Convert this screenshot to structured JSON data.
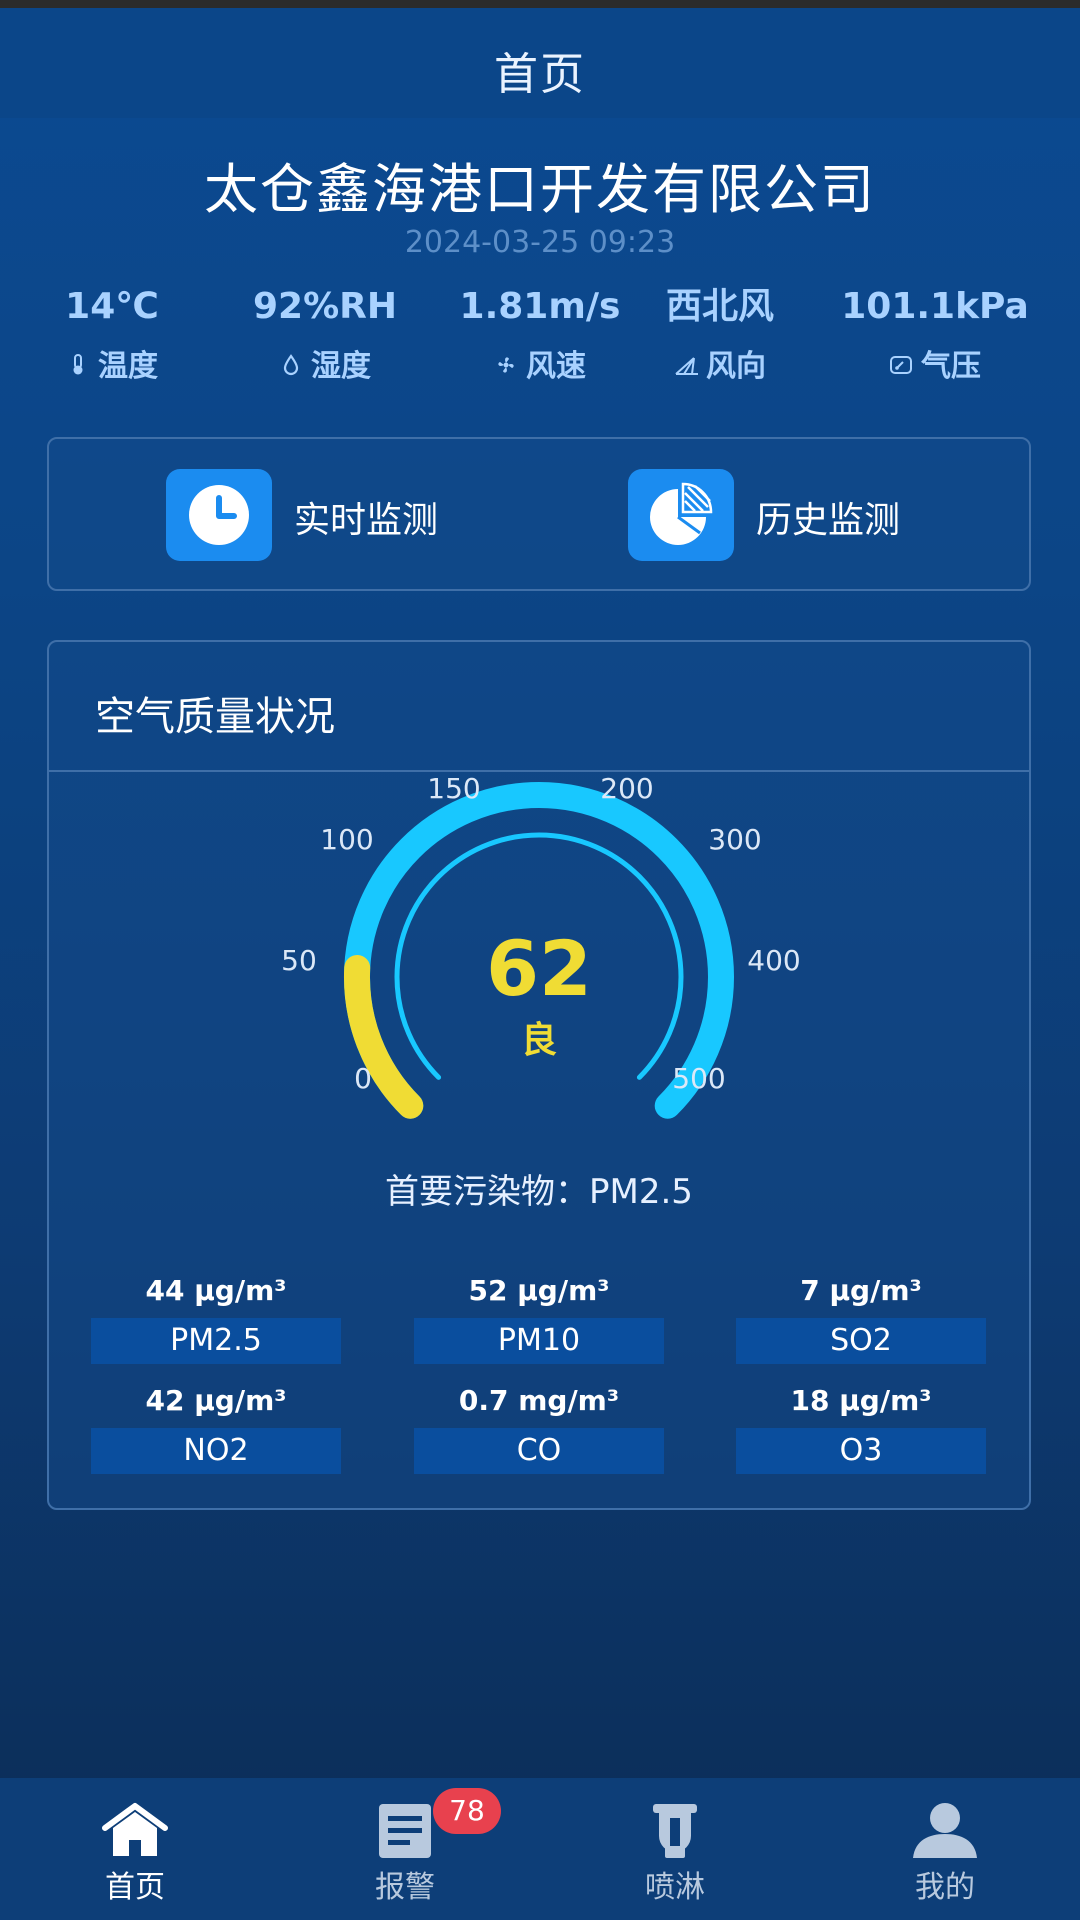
{
  "header": {
    "title": "首页"
  },
  "company": {
    "name": "太仓鑫海港口开发有限公司",
    "datetime": "2024-03-25 09:23"
  },
  "weather": [
    {
      "value": "14℃",
      "label": "温度",
      "icon": "thermometer-icon"
    },
    {
      "value": "92%RH",
      "label": "湿度",
      "icon": "droplet-icon"
    },
    {
      "value": "1.81m/s",
      "label": "风速",
      "icon": "fan-icon"
    },
    {
      "value": "西北风",
      "label": "风向",
      "icon": "wind-direction-icon"
    },
    {
      "value": "101.1kPa",
      "label": "气压",
      "icon": "barometer-icon"
    }
  ],
  "monitor": {
    "realtime_label": "实时监测",
    "history_label": "历史监测"
  },
  "air_quality": {
    "title": "空气质量状况",
    "aqi": "62",
    "aqi_value": 62,
    "level": "良",
    "primary_pollutant": "首要污染物：PM2.5",
    "scale_labels": [
      "0",
      "50",
      "100",
      "150",
      "200",
      "300",
      "400",
      "500"
    ],
    "pollutants": [
      {
        "value": "44 μg/m³",
        "name": "PM2.5"
      },
      {
        "value": "52 μg/m³",
        "name": "PM10"
      },
      {
        "value": "7 μg/m³",
        "name": "SO2"
      },
      {
        "value": "42 μg/m³",
        "name": "NO2"
      },
      {
        "value": "0.7 mg/m³",
        "name": "CO"
      },
      {
        "value": "18 μg/m³",
        "name": "O3"
      }
    ]
  },
  "colors": {
    "accent": "#18c8ff",
    "gauge_fill": "#f0dc34",
    "badge": "#e8414e",
    "tile": "#1b8cf0"
  },
  "tabs": [
    {
      "label": "首页",
      "icon": "home-icon",
      "active": true
    },
    {
      "label": "报警",
      "icon": "alarm-list-icon",
      "badge": "78"
    },
    {
      "label": "喷淋",
      "icon": "sprinkler-icon"
    },
    {
      "label": "我的",
      "icon": "user-icon"
    }
  ]
}
